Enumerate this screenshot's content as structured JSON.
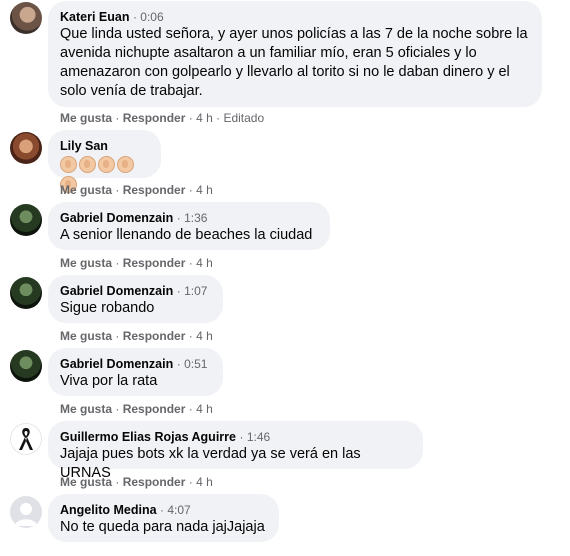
{
  "separator": "·",
  "comments": [
    {
      "name": "Kateri Euan",
      "time": "0:06",
      "text": "Que linda usted señora, y ayer unos policías a las 7 de la noche sobre la avenida nichupte asaltaron a un familiar mío, eran 5 oficiales y lo amenazaron con golpearlo y llevarlo al torito si no le daban dinero y el solo venía de trabajar.",
      "like": "Me gusta",
      "reply": "Responder",
      "age": "4 h",
      "edited": "Editado"
    },
    {
      "name": "Lily San",
      "time": "",
      "text": "👏👏👏👏👏",
      "like": "Me gusta",
      "reply": "Responder",
      "age": "4 h"
    },
    {
      "name": "Gabriel Domenzain",
      "time": "1:36",
      "text": "A senior llenando de beaches la ciudad",
      "like": "Me gusta",
      "reply": "Responder",
      "age": "4 h"
    },
    {
      "name": "Gabriel Domenzain",
      "time": "1:07",
      "text": "Sigue robando",
      "like": "Me gusta",
      "reply": "Responder",
      "age": "4 h"
    },
    {
      "name": "Gabriel Domenzain",
      "time": "0:51",
      "text": "Viva por la rata",
      "like": "Me gusta",
      "reply": "Responder",
      "age": "4 h"
    },
    {
      "name": "Guillermo Elias Rojas Aguirre",
      "time": "1:46",
      "text": "Jajaja pues bots xk la verdad ya se verá en las URNAS",
      "like": "Me gusta",
      "reply": "Responder",
      "age": "4 h"
    },
    {
      "name": "Angelito Medina",
      "time": "4:07",
      "text": "No te queda para nada jajJajaja"
    }
  ]
}
